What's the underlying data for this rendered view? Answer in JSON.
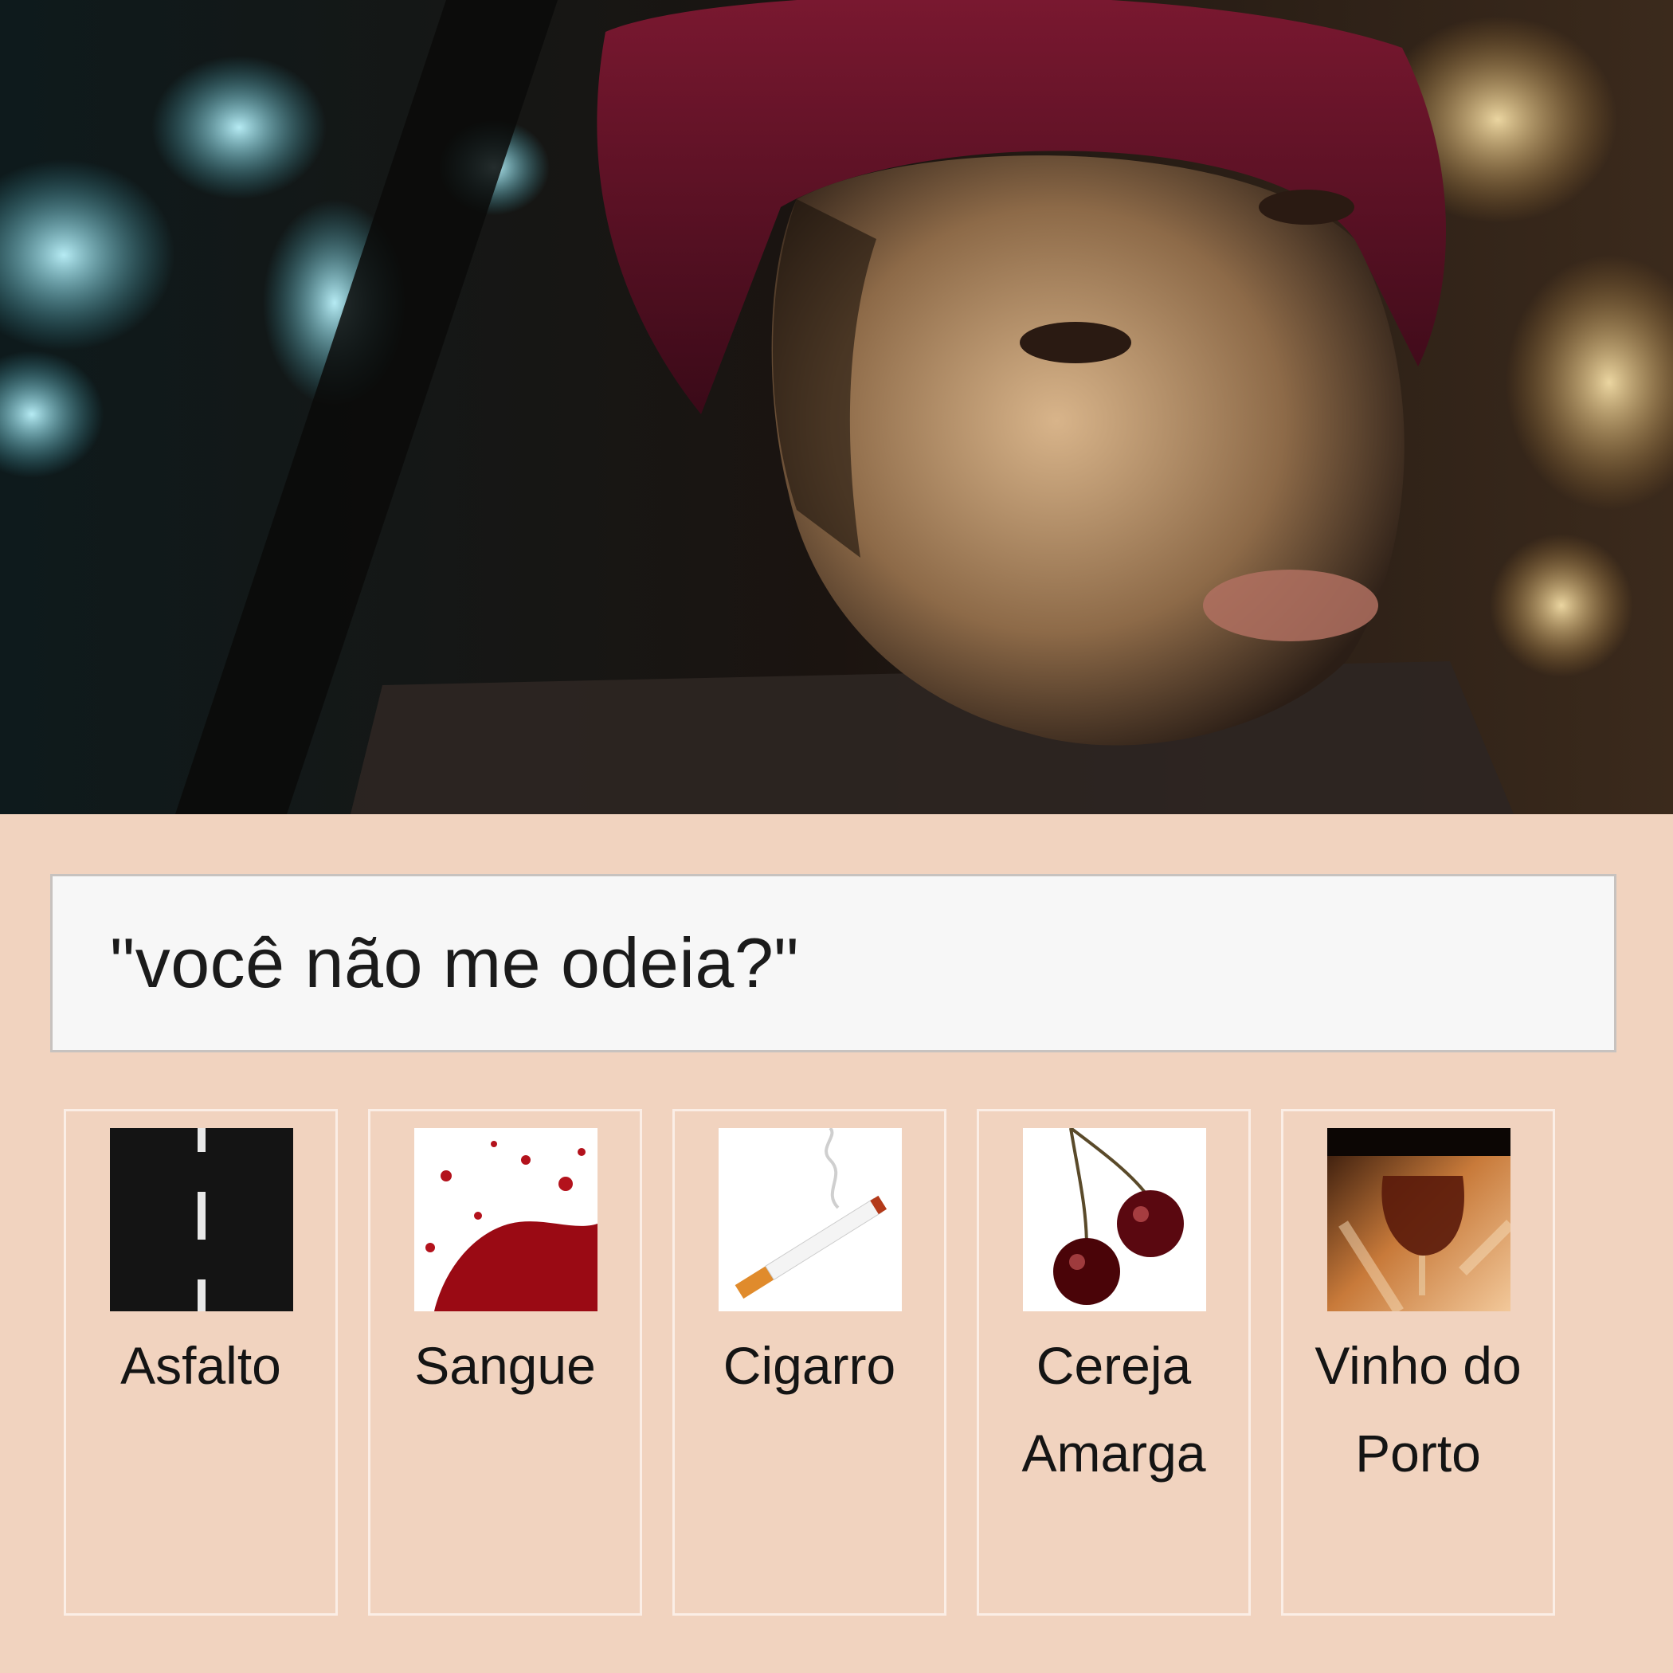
{
  "quote": "\"você não me odeia?\"",
  "cards": [
    {
      "label": "Asfalto",
      "icon": "asphalt-road-icon"
    },
    {
      "label": "Sangue",
      "icon": "blood-splatter-icon"
    },
    {
      "label": "Cigarro",
      "icon": "cigarette-icon"
    },
    {
      "label": "Cereja Amarga",
      "icon": "cherry-icon"
    },
    {
      "label": "Vinho do Porto",
      "icon": "wine-glass-icon"
    }
  ],
  "colors": {
    "background": "#f1d3bf",
    "quote_box": "#f7f7f7",
    "card_border": "#fbeee6",
    "text": "#141414"
  }
}
